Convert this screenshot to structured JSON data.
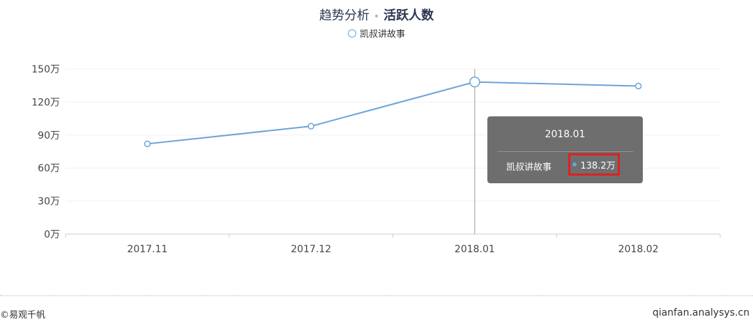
{
  "header": {
    "title_prefix": "趋势分析",
    "separator": "•",
    "title_metric": "活跃人数"
  },
  "legend": {
    "series_name": "凯叔讲故事"
  },
  "chart_data": {
    "type": "line",
    "categories": [
      "2017.11",
      "2017.12",
      "2018.01",
      "2018.02"
    ],
    "series": [
      {
        "name": "凯叔讲故事",
        "values": [
          82,
          98,
          138.2,
          134.5
        ],
        "color": "#6aa3d9"
      }
    ],
    "yticks": [
      0,
      30,
      60,
      90,
      120,
      150
    ],
    "ytick_suffix": "万",
    "ylim": [
      0,
      150
    ],
    "grid": true,
    "highlight_index": 2
  },
  "tooltip": {
    "title": "2018.01",
    "series_name": "凯叔讲故事",
    "value": "138.2万"
  },
  "footer": {
    "left": "©易观千帆",
    "right": "qianfan.analysys.cn"
  },
  "colors": {
    "line": "#6aa3d9",
    "highlight_border": "#e02020"
  }
}
